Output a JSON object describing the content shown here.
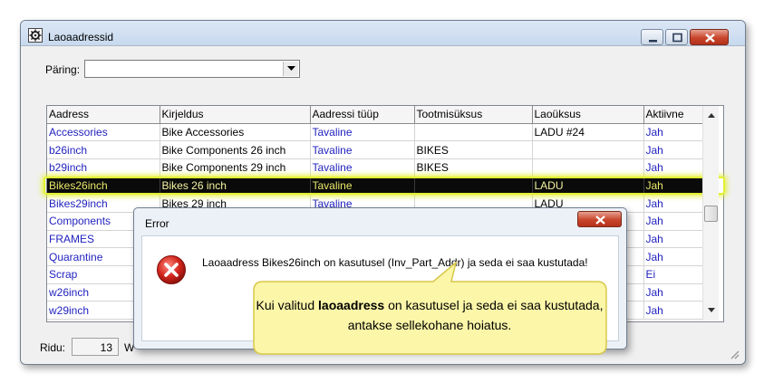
{
  "window": {
    "title": "Laoaadressid",
    "app_icon": "settings-window-icon",
    "buttons": [
      "minimize-icon",
      "maximize-icon",
      "close-icon"
    ]
  },
  "query": {
    "label": "Päring:",
    "value": ""
  },
  "grid": {
    "columns": [
      "Aadress",
      "Kirjeldus",
      "Aadressi tüüp",
      "Tootmisüksus",
      "Laoüksus",
      "Aktiivne"
    ],
    "rows": [
      {
        "address": "Accessories",
        "description": "Bike Accessories",
        "type": "Tavaline",
        "production_unit": "",
        "warehouse": "LADU #24",
        "active": "Jah"
      },
      {
        "address": "b26inch",
        "description": "Bike Components 26 inch",
        "type": "Tavaline",
        "production_unit": "BIKES",
        "warehouse": "",
        "active": "Jah"
      },
      {
        "address": "b29inch",
        "description": "Bike Components 29 inch",
        "type": "Tavaline",
        "production_unit": "BIKES",
        "warehouse": "",
        "active": "Jah"
      },
      {
        "address": "Bikes26inch",
        "description": "Bikes 26 inch",
        "type": "Tavaline",
        "production_unit": "",
        "warehouse": "LADU",
        "active": "Jah"
      },
      {
        "address": "Bikes29inch",
        "description": "Bikes 29 inch",
        "type": "Tavaline",
        "production_unit": "",
        "warehouse": "LADU",
        "active": "Jah"
      },
      {
        "address": "Components",
        "description": "",
        "type": "",
        "production_unit": "",
        "warehouse": "",
        "active": "Jah"
      },
      {
        "address": "FRAMES",
        "description": "",
        "type": "",
        "production_unit": "",
        "warehouse": "",
        "active": "Jah"
      },
      {
        "address": "Quarantine",
        "description": "",
        "type": "",
        "production_unit": "",
        "warehouse": "",
        "active": "Jah"
      },
      {
        "address": "Scrap",
        "description": "",
        "type": "",
        "production_unit": "",
        "warehouse": "",
        "active": "Ei"
      },
      {
        "address": "w26inch",
        "description": "",
        "type": "",
        "production_unit": "",
        "warehouse": "",
        "active": "Jah"
      },
      {
        "address": "w29inch",
        "description": "",
        "type": "",
        "production_unit": "",
        "warehouse": "",
        "active": "Jah"
      }
    ],
    "selected_address": "Bikes26inch"
  },
  "status": {
    "rows_label": "Ridu:",
    "rows_count": "13",
    "truncated_label": "W"
  },
  "error_dialog": {
    "title": "Error",
    "message": "Laoaadress Bikes26inch on kasutusel (Inv_Part_Addr) ja seda ei saa kustutada!",
    "icon": "error-icon"
  },
  "callout": {
    "text_before": "Kui valitud ",
    "text_bold": "laoaadress",
    "text_after": " on kasutusel ja seda ei saa kustutada, antakse sellekohane hoiatus."
  },
  "colors": {
    "link_text": "#1f1fbf",
    "selection_glow": "#e2f033",
    "callout_fill": "#fbf6a8",
    "callout_border": "#d8c84a"
  }
}
